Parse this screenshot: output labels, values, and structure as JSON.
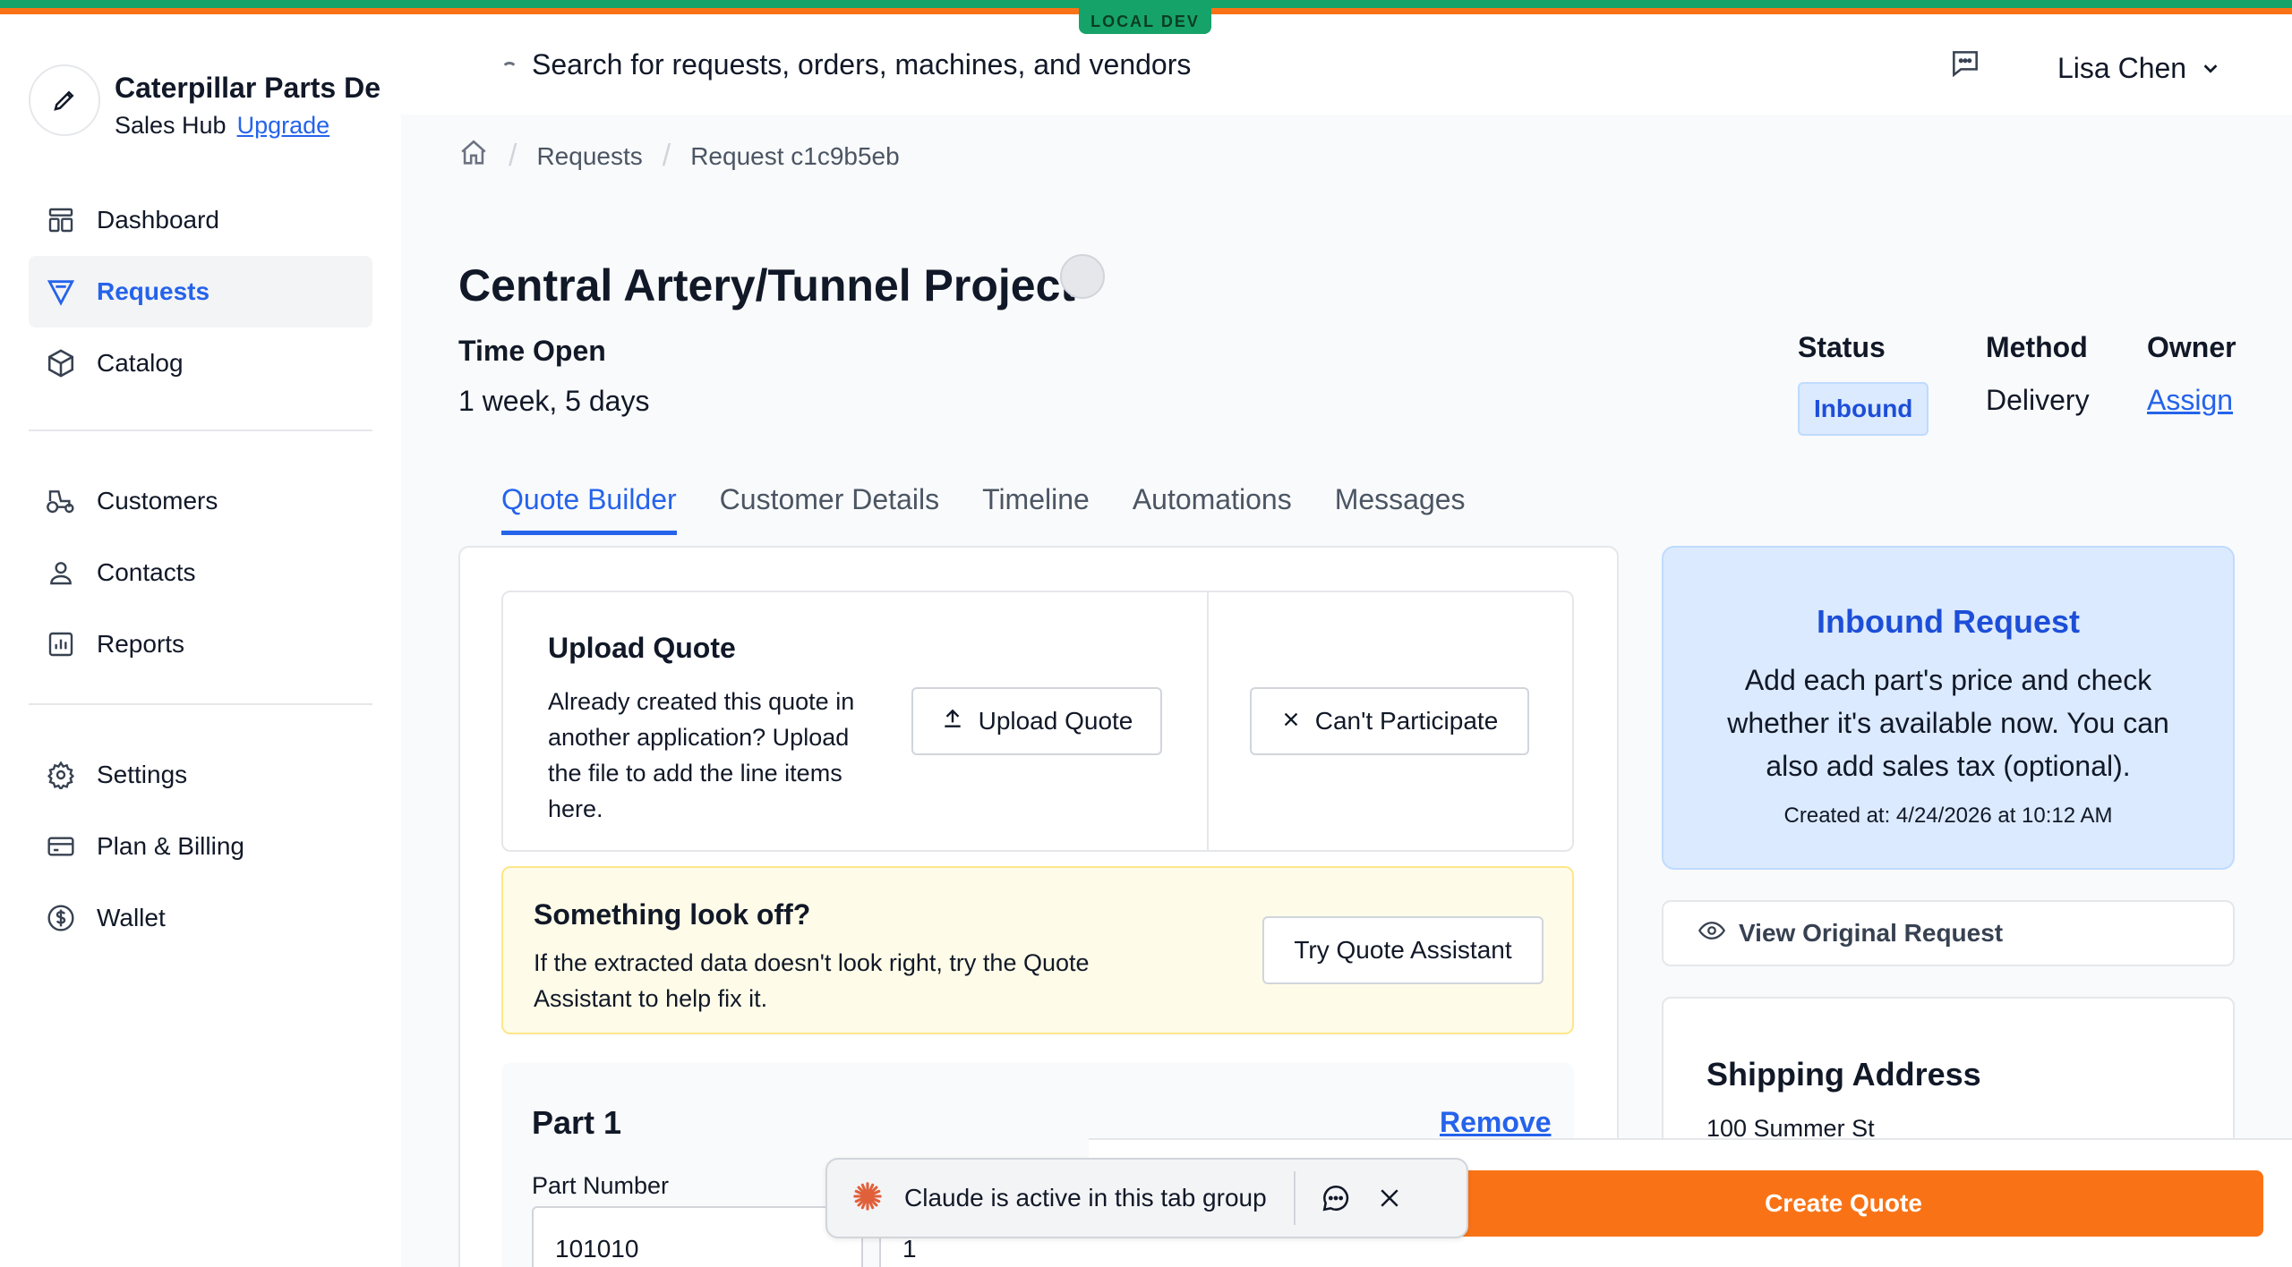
{
  "env_badge": "LOCAL DEV",
  "org": {
    "name": "Caterpillar Parts De",
    "plan": "Sales Hub",
    "upgrade": "Upgrade"
  },
  "nav": {
    "primary": [
      "Dashboard",
      "Requests",
      "Catalog"
    ],
    "secondary": [
      "Customers",
      "Contacts",
      "Reports"
    ],
    "account": [
      "Settings",
      "Plan & Billing",
      "Wallet"
    ],
    "active": "Requests"
  },
  "header": {
    "search_placeholder": "Search for requests, orders, machines, and vendors",
    "user": "Lisa Chen"
  },
  "breadcrumb": {
    "items": [
      "Requests",
      "Request c1c9b5eb"
    ]
  },
  "request": {
    "title": "Central Artery/Tunnel Project",
    "time_open_label": "Time Open",
    "time_open_value": "1 week, 5 days",
    "status_label": "Status",
    "status_value": "Inbound",
    "method_label": "Method",
    "method_value": "Delivery",
    "owner_label": "Owner",
    "owner_value": "Assign"
  },
  "tabs": [
    "Quote Builder",
    "Customer Details",
    "Timeline",
    "Automations",
    "Messages"
  ],
  "upload": {
    "title": "Upload Quote",
    "description": "Already created this quote in another application? Upload the file to add the line items here.",
    "upload_button": "Upload Quote",
    "cant_participate_button": "Can't Participate"
  },
  "warning": {
    "title": "Something look off?",
    "description": "If the extracted data doesn't look right, try the Quote Assistant to help fix it.",
    "button": "Try Quote Assistant"
  },
  "part": {
    "title": "Part 1",
    "remove": "Remove",
    "part_number_label": "Part Number",
    "part_number_value": "101010",
    "quantity_value": "1"
  },
  "inbound_card": {
    "title": "Inbound Request",
    "description": "Add each part's price and check whether it's available now. You can also add sales tax (optional).",
    "created": "Created at: 4/24/2026 at 10:12 AM"
  },
  "view_original": "View Original Request",
  "shipping": {
    "title": "Shipping Address",
    "line1": "100 Summer St"
  },
  "create_quote": "Create Quote",
  "toast": {
    "text": "Claude is active in this tab group"
  },
  "colors": {
    "accent": "#2563eb",
    "cta": "#f97316",
    "env": "#16a36a"
  }
}
